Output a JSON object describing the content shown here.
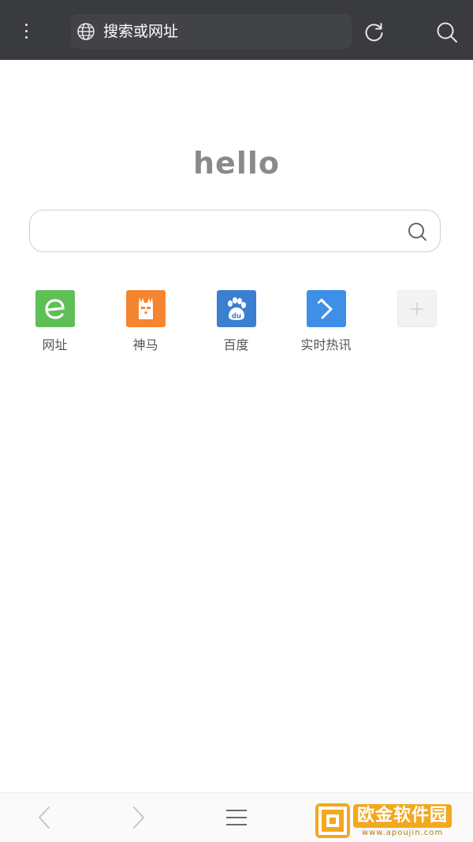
{
  "topbar": {
    "menu_icon": "vertical-dots-icon",
    "url_placeholder": "搜索或网址",
    "globe_icon": "globe-icon",
    "refresh_icon": "refresh-icon",
    "search_icon": "search-icon"
  },
  "home": {
    "greeting": "hello",
    "search_icon": "search-icon"
  },
  "quick_links": [
    {
      "label": "网址",
      "icon": "e-letter-icon",
      "color": "#5fbf57"
    },
    {
      "label": "神马",
      "icon": "alpaca-icon",
      "color": "#f6852f"
    },
    {
      "label": "百度",
      "icon": "baidu-paw-icon",
      "color": "#3a7fd0"
    },
    {
      "label": "实时热讯",
      "icon": "arrow-icon",
      "color": "#3d8fe8"
    },
    {
      "label": "",
      "icon": "plus-icon",
      "color": "#f3f3f3"
    }
  ],
  "bottombar": {
    "back_icon": "chevron-left-icon",
    "forward_icon": "chevron-right-icon",
    "menu_icon": "hamburger-menu-icon"
  },
  "watermark": {
    "title": "欧金软件园",
    "subtitle": "www.apoujin.com"
  }
}
